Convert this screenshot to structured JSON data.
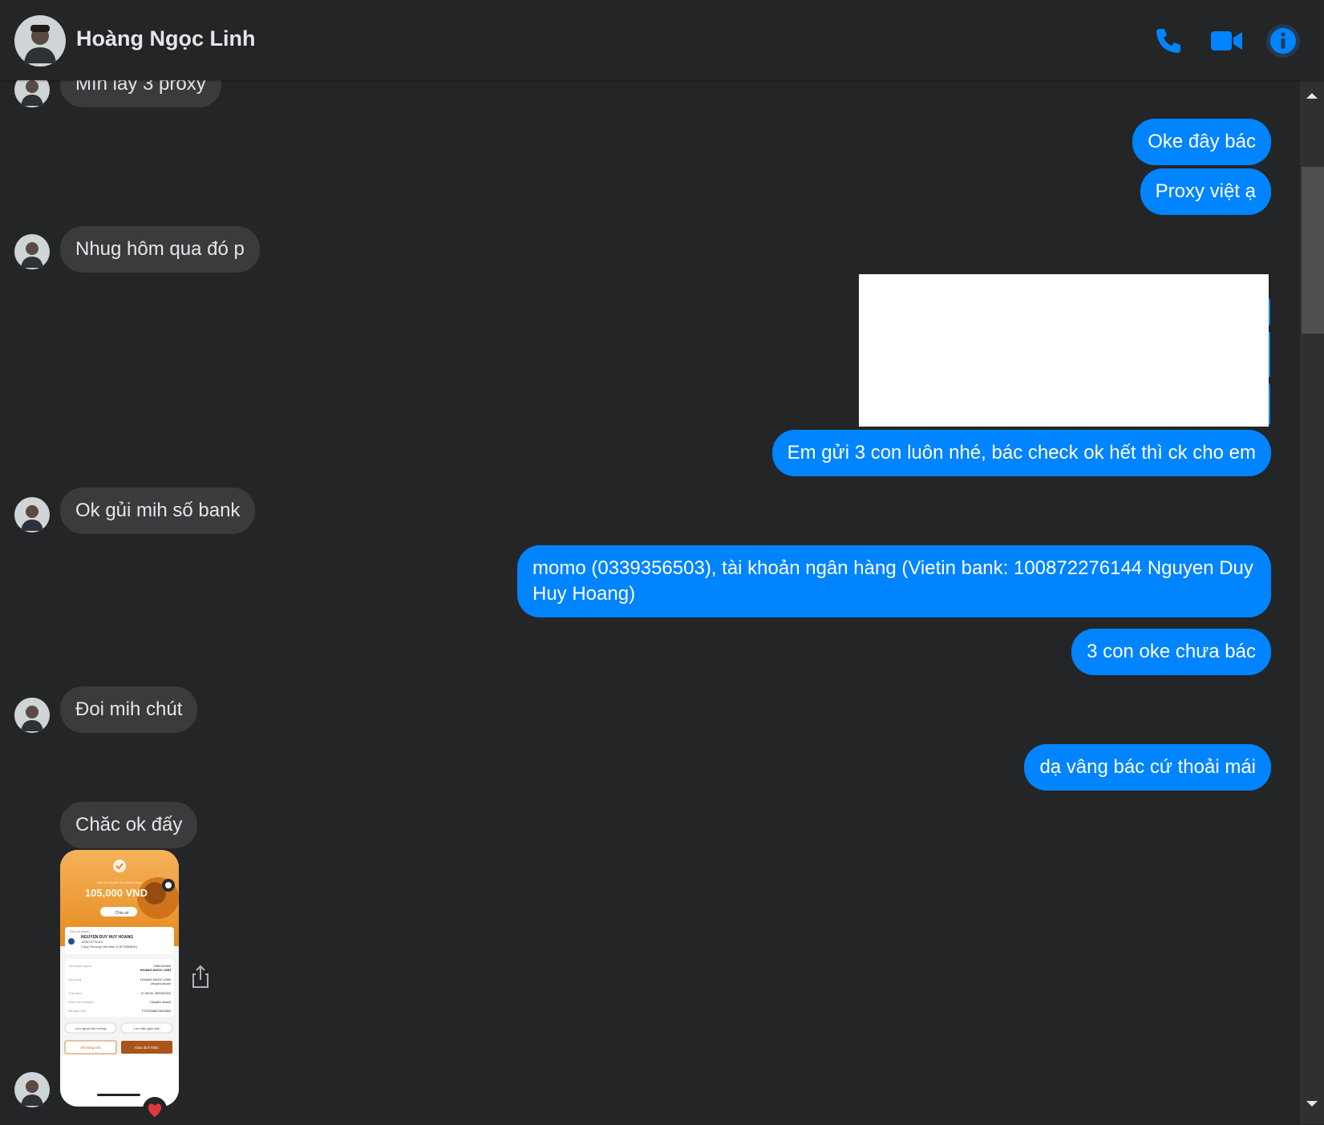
{
  "header": {
    "contact_name": "Hoàng Ngọc Linh",
    "icons": [
      "phone-icon",
      "video-call-icon",
      "info-icon"
    ],
    "accent_color": "#0084ff"
  },
  "messages": [
    {
      "direction": "incoming",
      "text": "Mìn lấy 3 proxy"
    },
    {
      "direction": "outgoing",
      "text": "Oke đây bác"
    },
    {
      "direction": "outgoing",
      "text": "Proxy việt ạ"
    },
    {
      "direction": "incoming",
      "text": "Nhug hôm qua đó p"
    },
    {
      "direction": "outgoing",
      "text": "Em gửi 3 con luôn nhé, bác check ok hết thì ck cho em"
    },
    {
      "direction": "incoming",
      "text": "Ok gủi mih số bank"
    },
    {
      "direction": "outgoing",
      "text": "momo (0339356503), tài khoản ngân hàng (Vietin bank: 100872276144 Nguyen Duy Huy Hoang)"
    },
    {
      "direction": "outgoing",
      "text": "3 con oke chưa bác"
    },
    {
      "direction": "incoming",
      "text": "Đoi mih chút"
    },
    {
      "direction": "outgoing",
      "text": "dạ vâng bác cứ thoải mái"
    },
    {
      "direction": "incoming",
      "text": "Chăc ok đấy"
    }
  ],
  "receipt": {
    "amount": "105,000 VND",
    "share_label": "Chia sẻ",
    "recipient_label": "Đến tài khoản",
    "recipient_name": "NGUYEN DUY HUY HOANG",
    "recipient_account": "100872276144",
    "recipient_bank": "Công Thương Việt Nam (VIETINBANK)",
    "rows": [
      {
        "label": "Tài khoản nguồn",
        "value": "0392111069"
      },
      {
        "label": "",
        "value": "HOANG NGOC LINH"
      },
      {
        "label": "Nội dung",
        "value": "HOANG NGOC LINH"
      },
      {
        "label": "",
        "value": "chuyen khoan"
      },
      {
        "label": "Thời gian",
        "value": "17:39:06, 08/04/2022"
      },
      {
        "label": "Hình thức chuyển",
        "value": "Chuyển nhanh"
      },
      {
        "label": "Mã giao dịch",
        "value": "FT22098872813560"
      }
    ],
    "chip_save_recipient": "Lưu người thụ hưởng",
    "chip_save_template": "Lưu mẫu giao dịch",
    "btn_home": "Về trang chủ",
    "btn_new": "Giao dịch khác",
    "reaction": "❤️"
  }
}
